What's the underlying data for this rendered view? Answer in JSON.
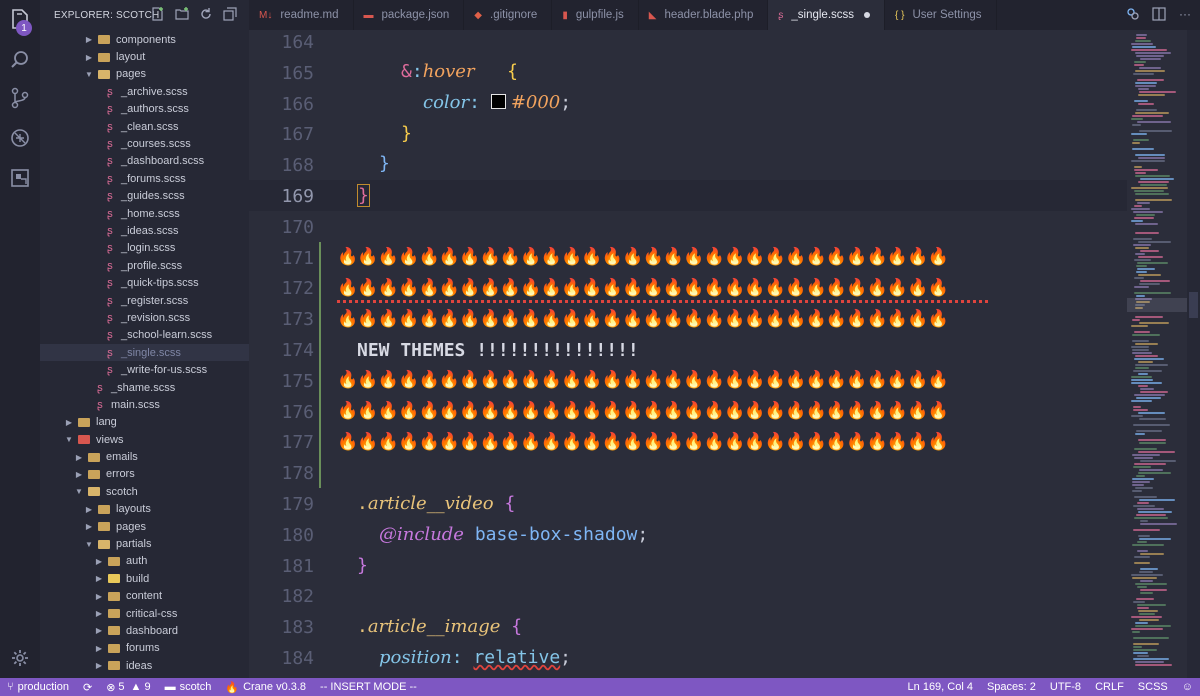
{
  "activity": {
    "badge": "1"
  },
  "explorer": {
    "title": "EXPLORER: SCOTCH",
    "items": [
      {
        "label": "components",
        "kind": "folder",
        "depth": 2,
        "open": false
      },
      {
        "label": "layout",
        "kind": "folder",
        "depth": 2,
        "open": false
      },
      {
        "label": "pages",
        "kind": "folder",
        "depth": 2,
        "open": true
      },
      {
        "label": "_archive.scss",
        "kind": "file",
        "depth": 3
      },
      {
        "label": "_authors.scss",
        "kind": "file",
        "depth": 3
      },
      {
        "label": "_clean.scss",
        "kind": "file",
        "depth": 3
      },
      {
        "label": "_courses.scss",
        "kind": "file",
        "depth": 3
      },
      {
        "label": "_dashboard.scss",
        "kind": "file",
        "depth": 3
      },
      {
        "label": "_forums.scss",
        "kind": "file",
        "depth": 3
      },
      {
        "label": "_guides.scss",
        "kind": "file",
        "depth": 3
      },
      {
        "label": "_home.scss",
        "kind": "file",
        "depth": 3
      },
      {
        "label": "_ideas.scss",
        "kind": "file",
        "depth": 3
      },
      {
        "label": "_login.scss",
        "kind": "file",
        "depth": 3
      },
      {
        "label": "_profile.scss",
        "kind": "file",
        "depth": 3
      },
      {
        "label": "_quick-tips.scss",
        "kind": "file",
        "depth": 3
      },
      {
        "label": "_register.scss",
        "kind": "file",
        "depth": 3
      },
      {
        "label": "_revision.scss",
        "kind": "file",
        "depth": 3
      },
      {
        "label": "_school-learn.scss",
        "kind": "file",
        "depth": 3
      },
      {
        "label": "_single.scss",
        "kind": "file",
        "depth": 3,
        "selected": true
      },
      {
        "label": "_write-for-us.scss",
        "kind": "file",
        "depth": 3
      },
      {
        "label": "_shame.scss",
        "kind": "file",
        "depth": 2
      },
      {
        "label": "main.scss",
        "kind": "file",
        "depth": 2
      },
      {
        "label": "lang",
        "kind": "folder",
        "depth": 0,
        "open": false
      },
      {
        "label": "views",
        "kind": "folder",
        "depth": 0,
        "open": true,
        "variant": "views"
      },
      {
        "label": "emails",
        "kind": "folder",
        "depth": 1,
        "open": false
      },
      {
        "label": "errors",
        "kind": "folder",
        "depth": 1,
        "open": false
      },
      {
        "label": "scotch",
        "kind": "folder",
        "depth": 1,
        "open": true
      },
      {
        "label": "layouts",
        "kind": "folder",
        "depth": 2,
        "open": false
      },
      {
        "label": "pages",
        "kind": "folder",
        "depth": 2,
        "open": false
      },
      {
        "label": "partials",
        "kind": "folder",
        "depth": 2,
        "open": true
      },
      {
        "label": "auth",
        "kind": "folder",
        "depth": 3,
        "open": false
      },
      {
        "label": "build",
        "kind": "folder",
        "depth": 3,
        "open": false,
        "variant": "special"
      },
      {
        "label": "content",
        "kind": "folder",
        "depth": 3,
        "open": false
      },
      {
        "label": "critical-css",
        "kind": "folder",
        "depth": 3,
        "open": false
      },
      {
        "label": "dashboard",
        "kind": "folder",
        "depth": 3,
        "open": false
      },
      {
        "label": "forums",
        "kind": "folder",
        "depth": 3,
        "open": false
      },
      {
        "label": "ideas",
        "kind": "folder",
        "depth": 3,
        "open": false
      }
    ]
  },
  "tabs": [
    {
      "label": "readme.md",
      "icon": "markdown-icon",
      "glyph": "M↓",
      "color": "#d8574f"
    },
    {
      "label": "package.json",
      "icon": "npm-icon",
      "glyph": "▬",
      "color": "#d8574f"
    },
    {
      "label": ".gitignore",
      "icon": "git-icon",
      "glyph": "◆",
      "color": "#e06048"
    },
    {
      "label": "gulpfile.js",
      "icon": "gulp-icon",
      "glyph": "▮",
      "color": "#d8574f"
    },
    {
      "label": "header.blade.php",
      "icon": "laravel-icon",
      "glyph": "◣",
      "color": "#d8574f"
    },
    {
      "label": "_single.scss",
      "icon": "sass-icon",
      "glyph": "ʂ",
      "color": "#d86b95",
      "active": true,
      "dirty": true
    },
    {
      "label": "User Settings",
      "icon": "braces-icon",
      "glyph": "{ }",
      "color": "#e8c85a"
    }
  ],
  "editor": {
    "line_numbers": [
      "164",
      "165",
      "166",
      "167",
      "168",
      "169",
      "170",
      "171",
      "172",
      "173",
      "174",
      "175",
      "176",
      "177",
      "178",
      "179",
      "180",
      "181",
      "182",
      "183",
      "184"
    ],
    "hover_selector_amp": "&",
    "hover_selector_colon": ":",
    "hover_selector_name": "hover",
    "open_brace": "{",
    "close_brace": "}",
    "color_prop": "color",
    "colon": ":",
    "color_value": "#000",
    "semicolon": ";",
    "fire_row": "🔥🔥🔥🔥🔥🔥🔥🔥🔥🔥🔥🔥🔥🔥🔥🔥🔥🔥🔥🔥🔥🔥🔥🔥🔥🔥🔥🔥🔥🔥",
    "new_themes": "NEW THEMES !!!!!!!!!!!!!!!",
    "article_video_dot": ".",
    "article_video_name": "article__video",
    "include_kw": "@include",
    "include_arg": "base-box-shadow",
    "article_image_dot": ".",
    "article_image_name": "article__image",
    "position_prop": "position",
    "position_value": "relative"
  },
  "status": {
    "branch": "production",
    "errors": "5",
    "warnings": "9",
    "folder": "scotch",
    "crane": "Crane v0.3.8",
    "mode": "-- INSERT MODE --",
    "position": "Ln 169, Col 4",
    "spaces": "Spaces: 2",
    "encoding": "UTF-8",
    "eol": "CRLF",
    "language": "SCSS"
  }
}
